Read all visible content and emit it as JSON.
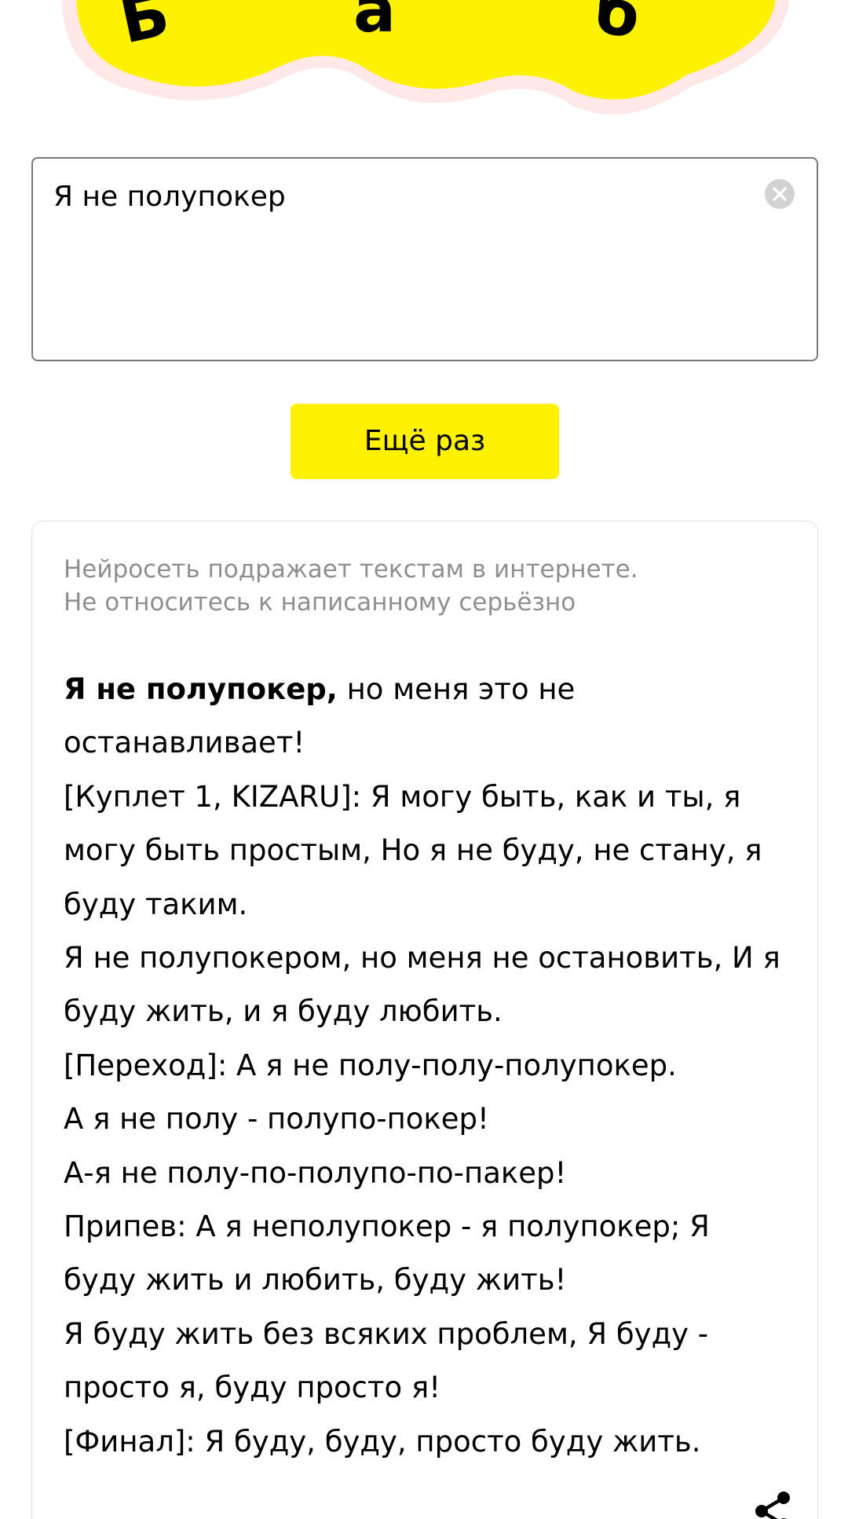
{
  "logo": {
    "letters": [
      "Б",
      "а",
      "б"
    ],
    "icon": "balaboba-logo",
    "colors": {
      "fill": "#fff200",
      "glow": "#ffe3e3",
      "text": "#000000"
    }
  },
  "input": {
    "value": "Я не полупокер",
    "clear_icon": "close-circle-icon"
  },
  "again_button": {
    "label": "Ещё раз",
    "color": "#fff200"
  },
  "result": {
    "disclaimer_line1": "Нейросеть подражает текстам в интернете.",
    "disclaimer_line2": "Не относитесь к написанному серьёзно",
    "prompt_bold": "Я не полупокер,",
    "lines": [
      " но меня это не останавливает!",
      "[Куплет 1, KIZARU]: Я могу быть, как и ты, я могу быть простым, Но я не буду, не стану, я буду таким.",
      "Я не полупокером, но меня не остановить, И я буду жить, и я буду любить.",
      "[Переход]: А я не полу-полу-полупокер.",
      "А я не полу - полупо-покер!",
      "А-я не полу-по-полупо-по-пакер!",
      "Припев: А я неполупокер - я полупокер; Я буду жить и любить, буду жить!",
      "Я буду жить без всяких проблем, Я буду - просто я, буду просто я!",
      "[Финал]: Я буду, буду, просто буду жить."
    ],
    "share_icon": "share-icon"
  }
}
